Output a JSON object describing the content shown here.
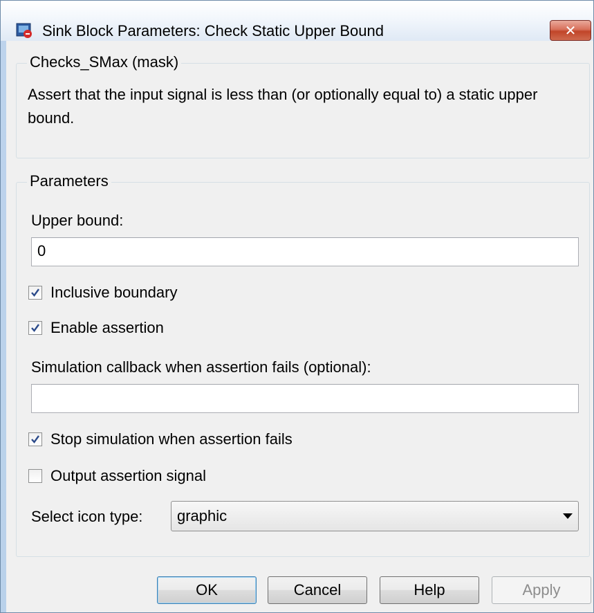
{
  "window": {
    "title": "Sink Block Parameters: Check Static Upper Bound",
    "close_label": "✕"
  },
  "mask_group": {
    "legend": "Checks_SMax (mask)",
    "description": "Assert that the input signal is less than (or optionally equal to) a static upper bound."
  },
  "params_group": {
    "legend": "Parameters",
    "upper_bound_label": "Upper bound:",
    "upper_bound_value": "0",
    "inclusive_boundary": {
      "label": "Inclusive boundary",
      "checked": true
    },
    "enable_assertion": {
      "label": "Enable assertion",
      "checked": true
    },
    "callback_label": "Simulation callback when assertion fails (optional):",
    "callback_value": "",
    "stop_simulation": {
      "label": "Stop simulation when assertion fails",
      "checked": true
    },
    "output_assertion": {
      "label": "Output assertion signal",
      "checked": false
    },
    "icon_type_label": "Select icon type:",
    "icon_type_value": "graphic"
  },
  "buttons": {
    "ok": "OK",
    "cancel": "Cancel",
    "help": "Help",
    "apply": "Apply"
  },
  "colors": {
    "accent": "#3c7fb1",
    "check": "#2b4a8a"
  },
  "icons": {
    "app": "simulink-block-icon",
    "close": "close-icon",
    "check": "checkmark-icon",
    "dropdown": "chevron-down-icon"
  }
}
